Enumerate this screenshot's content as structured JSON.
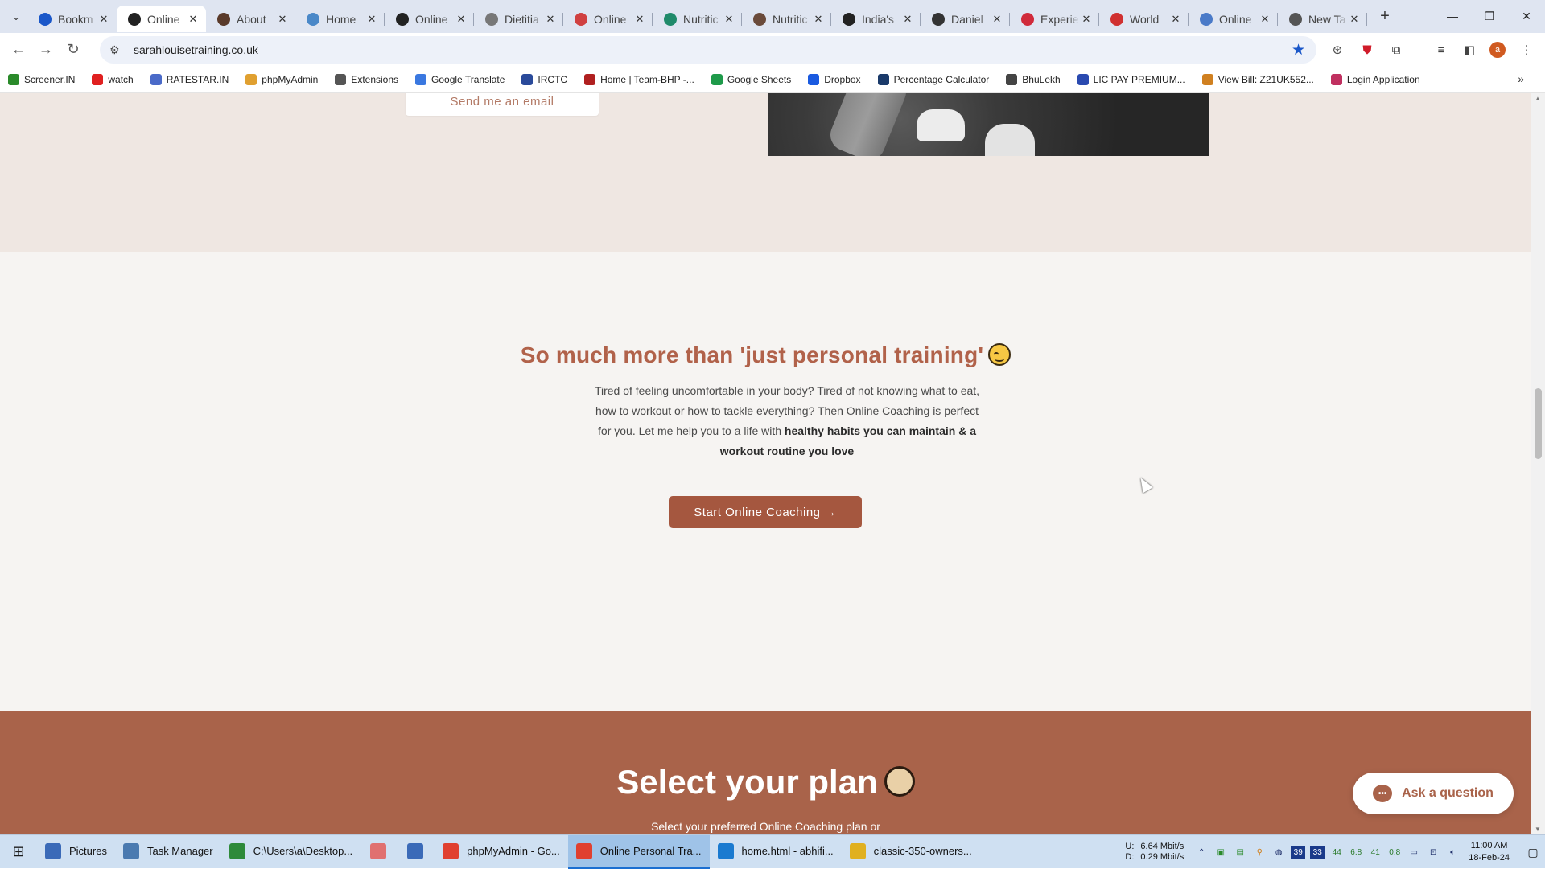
{
  "tabs": [
    {
      "title": "Bookm",
      "color": "#1a57c9",
      "active": false
    },
    {
      "title": "Online",
      "color": "#222222",
      "active": true
    },
    {
      "title": "About",
      "color": "#5a3a2a",
      "active": false
    },
    {
      "title": "Home",
      "color": "#4a88c8",
      "active": false
    },
    {
      "title": "Online",
      "color": "#222222",
      "active": false
    },
    {
      "title": "Dietitia",
      "color": "#777777",
      "active": false
    },
    {
      "title": "Online",
      "color": "#d04040",
      "active": false
    },
    {
      "title": "Nutritic",
      "color": "#1f8a6a",
      "active": false
    },
    {
      "title": "Nutritic",
      "color": "#6a4a3a",
      "active": false
    },
    {
      "title": "India's",
      "color": "#222222",
      "active": false
    },
    {
      "title": "Daniel",
      "color": "#333333",
      "active": false
    },
    {
      "title": "Experie",
      "color": "#d02a3a",
      "active": false
    },
    {
      "title": "World",
      "color": "#d03030",
      "active": false
    },
    {
      "title": "Online",
      "color": "#4a7ac8",
      "active": false
    },
    {
      "title": "New Ta",
      "color": "#555555",
      "active": false
    }
  ],
  "address": {
    "url": "sarahlouisetraining.co.uk"
  },
  "bookmarks": [
    {
      "label": "Screener.IN",
      "color": "#2a8a2a"
    },
    {
      "label": "watch",
      "color": "#e02020"
    },
    {
      "label": "RATESTAR.IN",
      "color": "#4a6ac8"
    },
    {
      "label": "phpMyAdmin",
      "color": "#e0a030"
    },
    {
      "label": "Extensions",
      "color": "#555555"
    },
    {
      "label": "Google Translate",
      "color": "#3a78e0"
    },
    {
      "label": "IRCTC",
      "color": "#2a4a9a"
    },
    {
      "label": "Home | Team-BHP -...",
      "color": "#b02020"
    },
    {
      "label": "Google Sheets",
      "color": "#1e9a4a"
    },
    {
      "label": "Dropbox",
      "color": "#1a5ae0"
    },
    {
      "label": "Percentage Calculator",
      "color": "#1a3a6a"
    },
    {
      "label": "BhuLekh",
      "color": "#444444"
    },
    {
      "label": "LIC PAY PREMIUM...",
      "color": "#2a4ab0"
    },
    {
      "label": "View Bill: Z21UK552...",
      "color": "#d08020"
    },
    {
      "label": "Login Application",
      "color": "#c03060"
    }
  ],
  "page": {
    "email_button": "Send me an email",
    "heading": "So much more than 'just personal training'",
    "para_plain": "Tired of feeling uncomfortable in your body? Tired of not knowing what to eat, how to workout or how to tackle everything? Then Online Coaching is perfect for you. Let me help you to a life with ",
    "para_bold": "healthy habits you can maintain & a workout routine you love",
    "cta": "Start Online Coaching →",
    "plan_heading": "Select your plan",
    "plan_sub": "Select your preferred Online Coaching plan or",
    "ask": "Ask a question",
    "accent": "#a9634a"
  },
  "taskbar": {
    "items": [
      {
        "label": "Pictures",
        "color": "#3a6ab8",
        "active": false
      },
      {
        "label": "Task Manager",
        "color": "#4a7ab0",
        "active": false
      },
      {
        "label": "C:\\Users\\a\\Desktop...",
        "color": "#2e8a3a",
        "active": false
      },
      {
        "label": "",
        "color": "#e07070",
        "active": false
      },
      {
        "label": "",
        "color": "#3a6ab8",
        "active": false
      },
      {
        "label": "phpMyAdmin - Go...",
        "color": "#e04030",
        "active": false
      },
      {
        "label": "Online Personal Tra...",
        "color": "#e04030",
        "active": true
      },
      {
        "label": "home.html - abhifi...",
        "color": "#1a7ad0",
        "active": false
      },
      {
        "label": "classic-350-owners...",
        "color": "#e0b020",
        "active": false
      }
    ],
    "net_up_label": "U:",
    "net_down_label": "D:",
    "net_up": "6.64 Mbit/s",
    "net_down": "0.29 Mbit/s",
    "tray_numbers": [
      "39",
      "33",
      "44",
      "6.8",
      "41",
      "0.8"
    ],
    "time": "11:00 AM",
    "date": "18-Feb-24"
  }
}
